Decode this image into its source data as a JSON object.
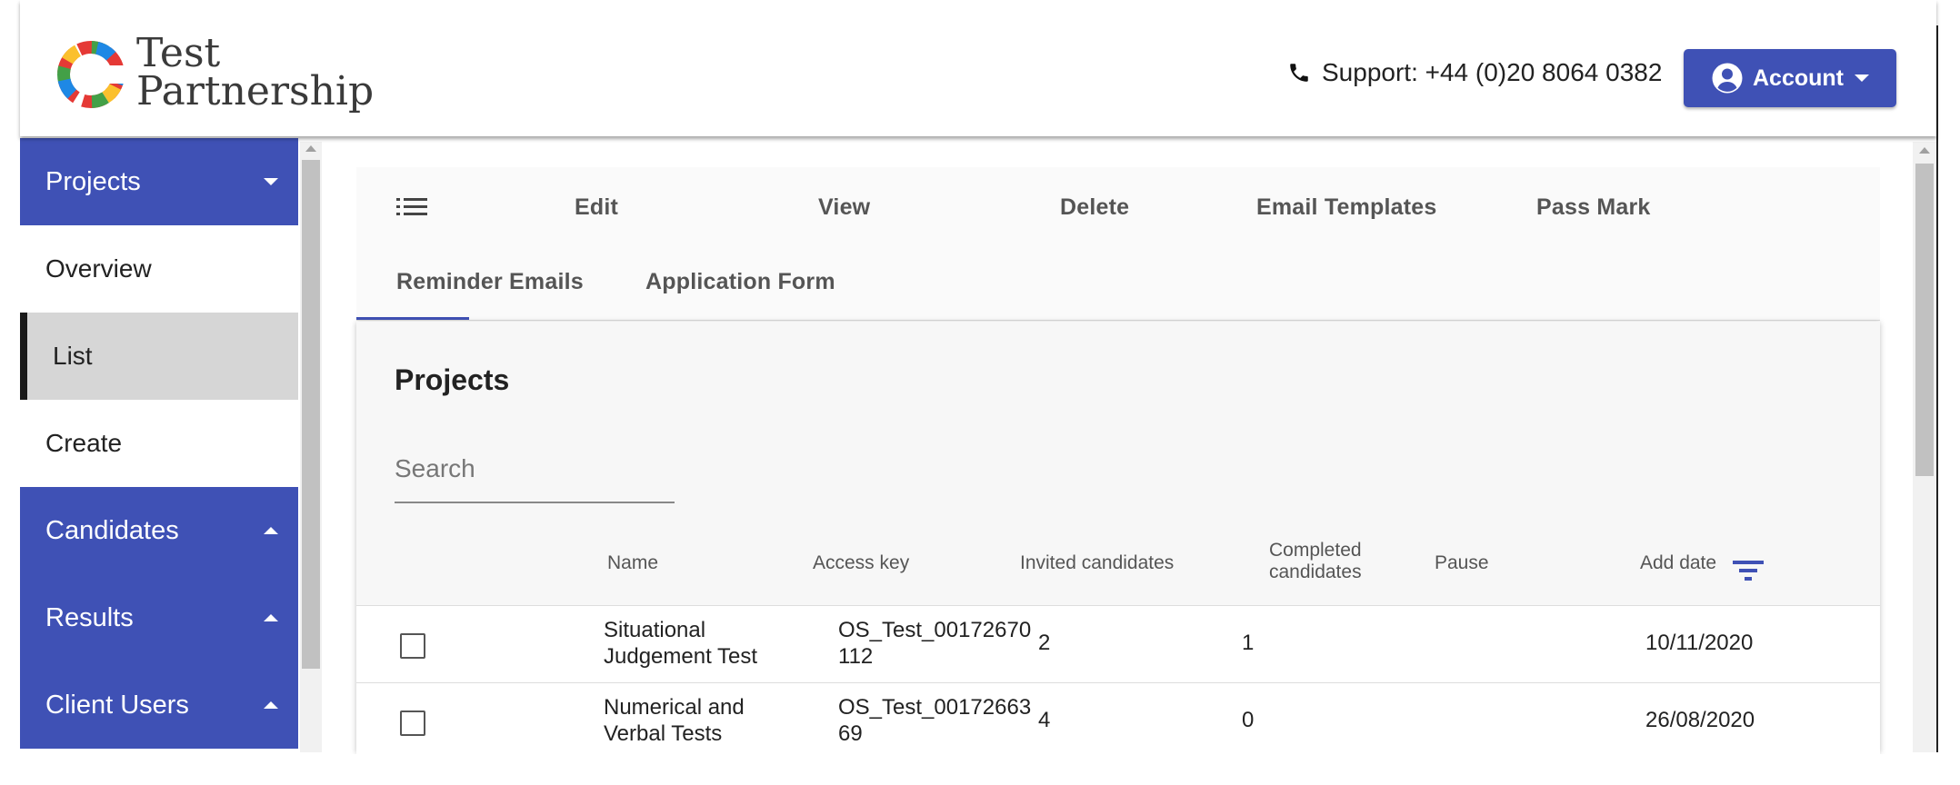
{
  "brand": {
    "line1": "Test",
    "line2": "Partnership"
  },
  "header": {
    "support_text": "Support: +44 (0)20 8064 0382",
    "account_label": "Account"
  },
  "sidebar": {
    "sections": [
      {
        "label": "Projects",
        "expanded": true
      },
      {
        "label": "Candidates",
        "expanded": false
      },
      {
        "label": "Results",
        "expanded": false
      },
      {
        "label": "Client Users",
        "expanded": false
      }
    ],
    "project_items": [
      "Overview",
      "List",
      "Create"
    ],
    "active_item": "List"
  },
  "toolbar": {
    "items": [
      "Edit",
      "View",
      "Delete",
      "Email Templates",
      "Pass Mark",
      "Reminder Emails",
      "Application Form"
    ]
  },
  "projects": {
    "title": "Projects",
    "search_placeholder": "Search",
    "columns": [
      "Name",
      "Access key",
      "Invited candidates",
      "Completed candidates",
      "Pause",
      "Add date"
    ],
    "completed_line1": "Completed",
    "completed_line2": "candidates",
    "rows": [
      {
        "name_line1": "Situational",
        "name_line2": "Judgement Test",
        "key_line1": "OS_Test_00172670",
        "key_line2": "112",
        "invited": "2",
        "completed": "1",
        "pause": "",
        "add_date": "10/11/2020"
      },
      {
        "name_line1": "Numerical and",
        "name_line2": "Verbal Tests",
        "key_line1": "OS_Test_00172663",
        "key_line2": "69",
        "invited": "4",
        "completed": "0",
        "pause": "",
        "add_date": "26/08/2020"
      }
    ]
  },
  "colors": {
    "primary": "#3f51b5",
    "active_item_bg": "#d6d6d6"
  }
}
